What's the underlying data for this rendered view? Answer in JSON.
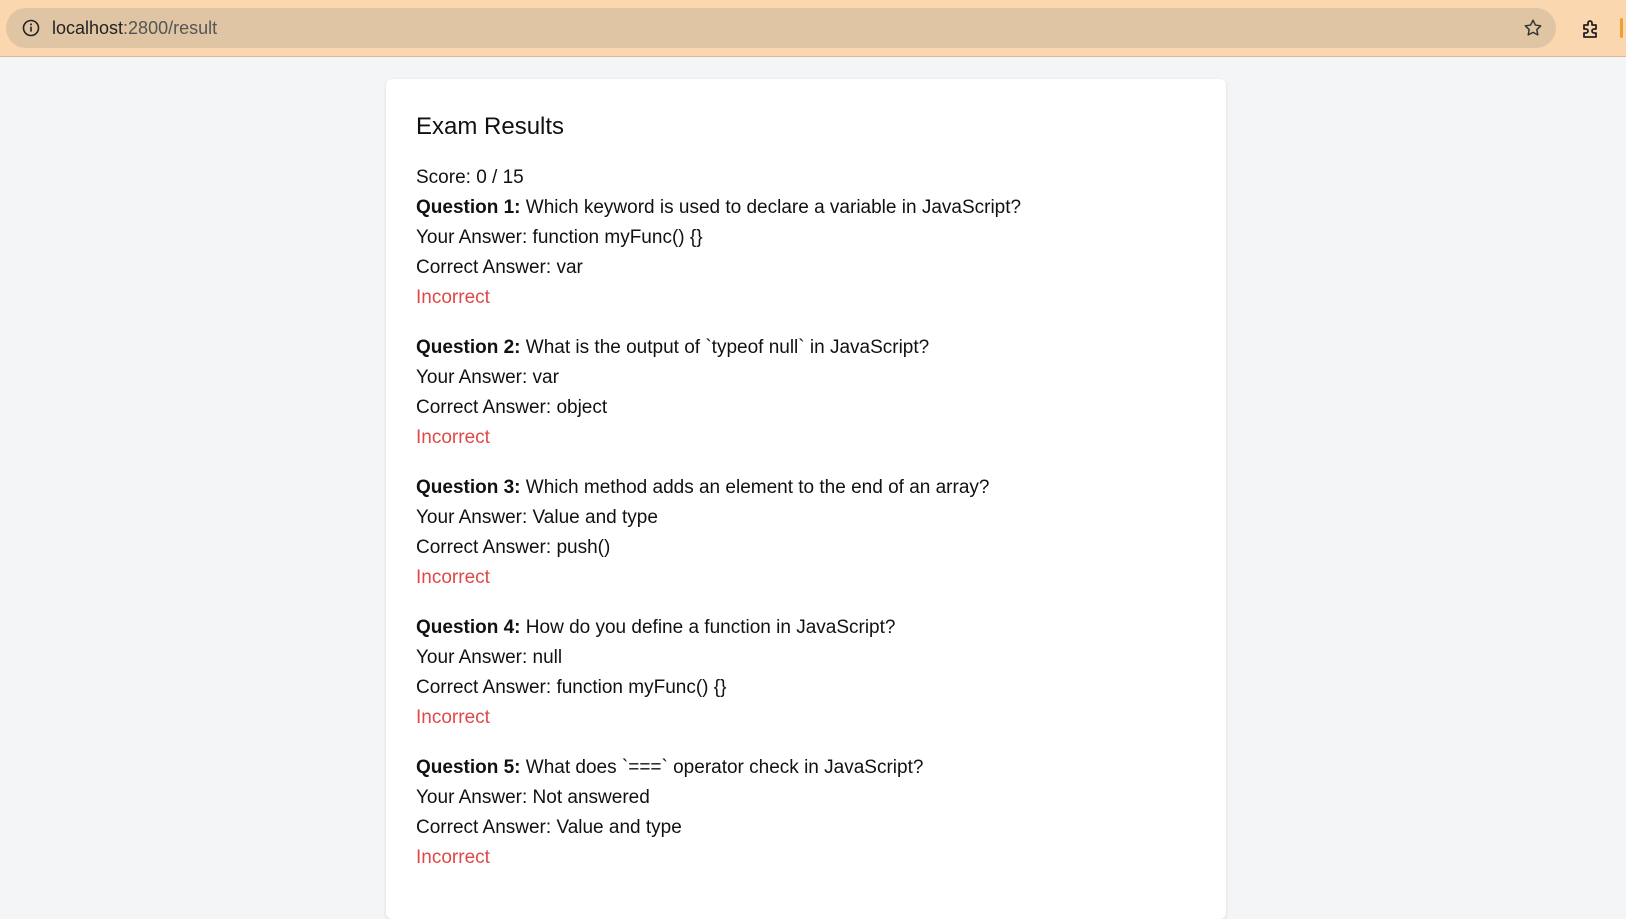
{
  "browser": {
    "url_host": "localhost",
    "url_path": ":2800/result"
  },
  "results": {
    "title": "Exam Results",
    "score_text": "Score: 0 / 15",
    "your_answer_prefix": "Your Answer: ",
    "correct_answer_prefix": "Correct Answer: ",
    "questions": [
      {
        "label": "Question 1:",
        "text": " Which keyword is used to declare a variable in JavaScript?",
        "your_answer": "function myFunc() {}",
        "correct_answer": "var",
        "status": "Incorrect"
      },
      {
        "label": "Question 2:",
        "text": " What is the output of `typeof null` in JavaScript?",
        "your_answer": "var",
        "correct_answer": "object",
        "status": "Incorrect"
      },
      {
        "label": "Question 3:",
        "text": " Which method adds an element to the end of an array?",
        "your_answer": "Value and type",
        "correct_answer": "push()",
        "status": "Incorrect"
      },
      {
        "label": "Question 4:",
        "text": " How do you define a function in JavaScript?",
        "your_answer": "null",
        "correct_answer": "function myFunc() {}",
        "status": "Incorrect"
      },
      {
        "label": "Question 5:",
        "text": " What does `===` operator check in JavaScript?",
        "your_answer": "Not answered",
        "correct_answer": "Value and type",
        "status": "Incorrect"
      }
    ]
  },
  "colors": {
    "incorrect": "#e04848",
    "browser_bar": "#fbd7b0"
  }
}
